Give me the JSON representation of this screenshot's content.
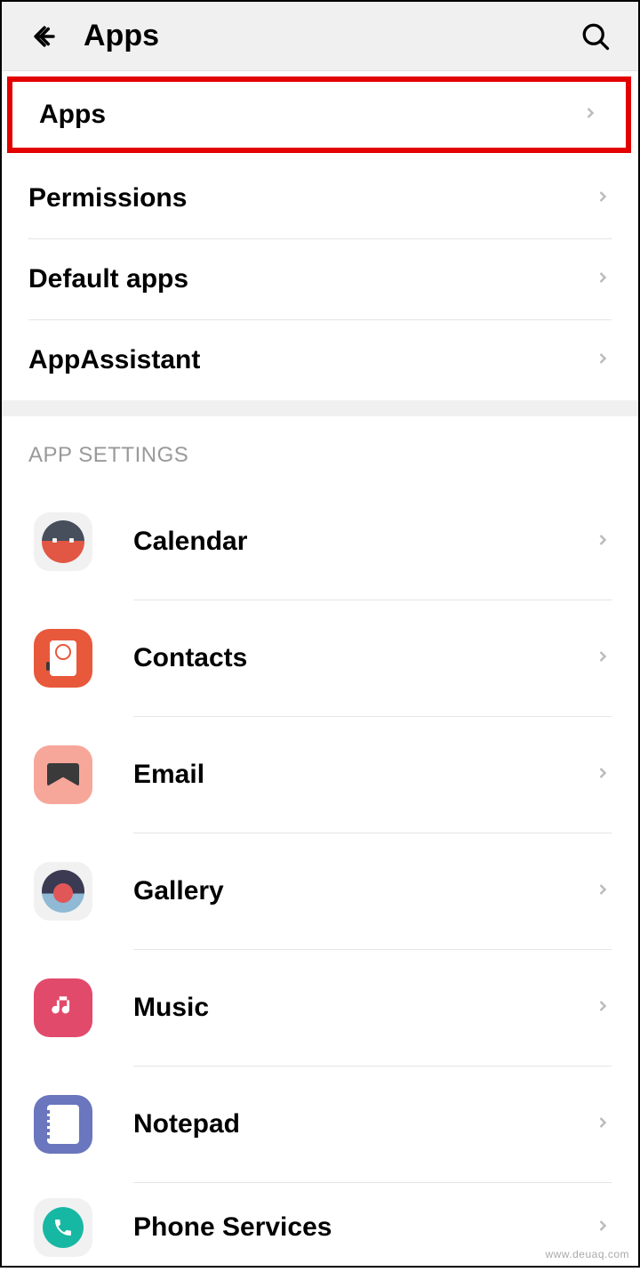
{
  "header": {
    "title": "Apps"
  },
  "main_items": [
    {
      "label": "Apps",
      "highlighted": true
    },
    {
      "label": "Permissions",
      "highlighted": false
    },
    {
      "label": "Default apps",
      "highlighted": false
    },
    {
      "label": "AppAssistant",
      "highlighted": false
    }
  ],
  "section_header": "APP SETTINGS",
  "apps": [
    {
      "label": "Calendar",
      "icon": "calendar"
    },
    {
      "label": "Contacts",
      "icon": "contacts"
    },
    {
      "label": "Email",
      "icon": "email"
    },
    {
      "label": "Gallery",
      "icon": "gallery"
    },
    {
      "label": "Music",
      "icon": "music"
    },
    {
      "label": "Notepad",
      "icon": "notepad"
    },
    {
      "label": "Phone Services",
      "icon": "phone"
    }
  ],
  "watermark": "www.deuaq.com"
}
